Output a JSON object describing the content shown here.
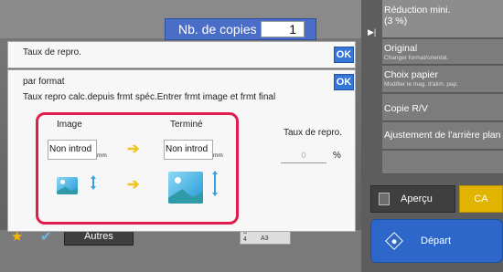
{
  "copies": {
    "label": "Nb. de copies",
    "value": "1"
  },
  "side_menu": [
    {
      "title": "Réduction mini.",
      "subtitle": "(3 %)"
    },
    {
      "title": "Original",
      "subtitle": "Changer format/orientat."
    },
    {
      "title": "Choix papier",
      "subtitle": "Modifier le mag. d'alim. pap."
    },
    {
      "title": "Copie R/V",
      "subtitle": ""
    },
    {
      "title": "Ajustement de l'arrière plan",
      "subtitle": ""
    }
  ],
  "buttons": {
    "preview": "Aperçu",
    "ca": "CA",
    "start": "Départ",
    "others": "Autres",
    "ok": "OK"
  },
  "tray": {
    "n3": "3",
    "n4": "4",
    "size": "A3"
  },
  "dialog_repro": {
    "title": "Taux de repro."
  },
  "dialog_format": {
    "title": "par format",
    "description": "Taux repro calc.depuis frmt spéc.Entrer frmt image et frmt final",
    "image_label": "Image",
    "finished_label": "Terminé",
    "image_value": "Non introd",
    "finished_value": "Non introd",
    "unit": "mm",
    "rate_label": "Taux de repro.",
    "rate_value": "0",
    "percent": "%"
  },
  "colors": {
    "accent_blue": "#3676d6",
    "highlight_red": "#e01d4b",
    "ca_yellow": "#e0b400",
    "start_blue": "#2c67c9"
  }
}
